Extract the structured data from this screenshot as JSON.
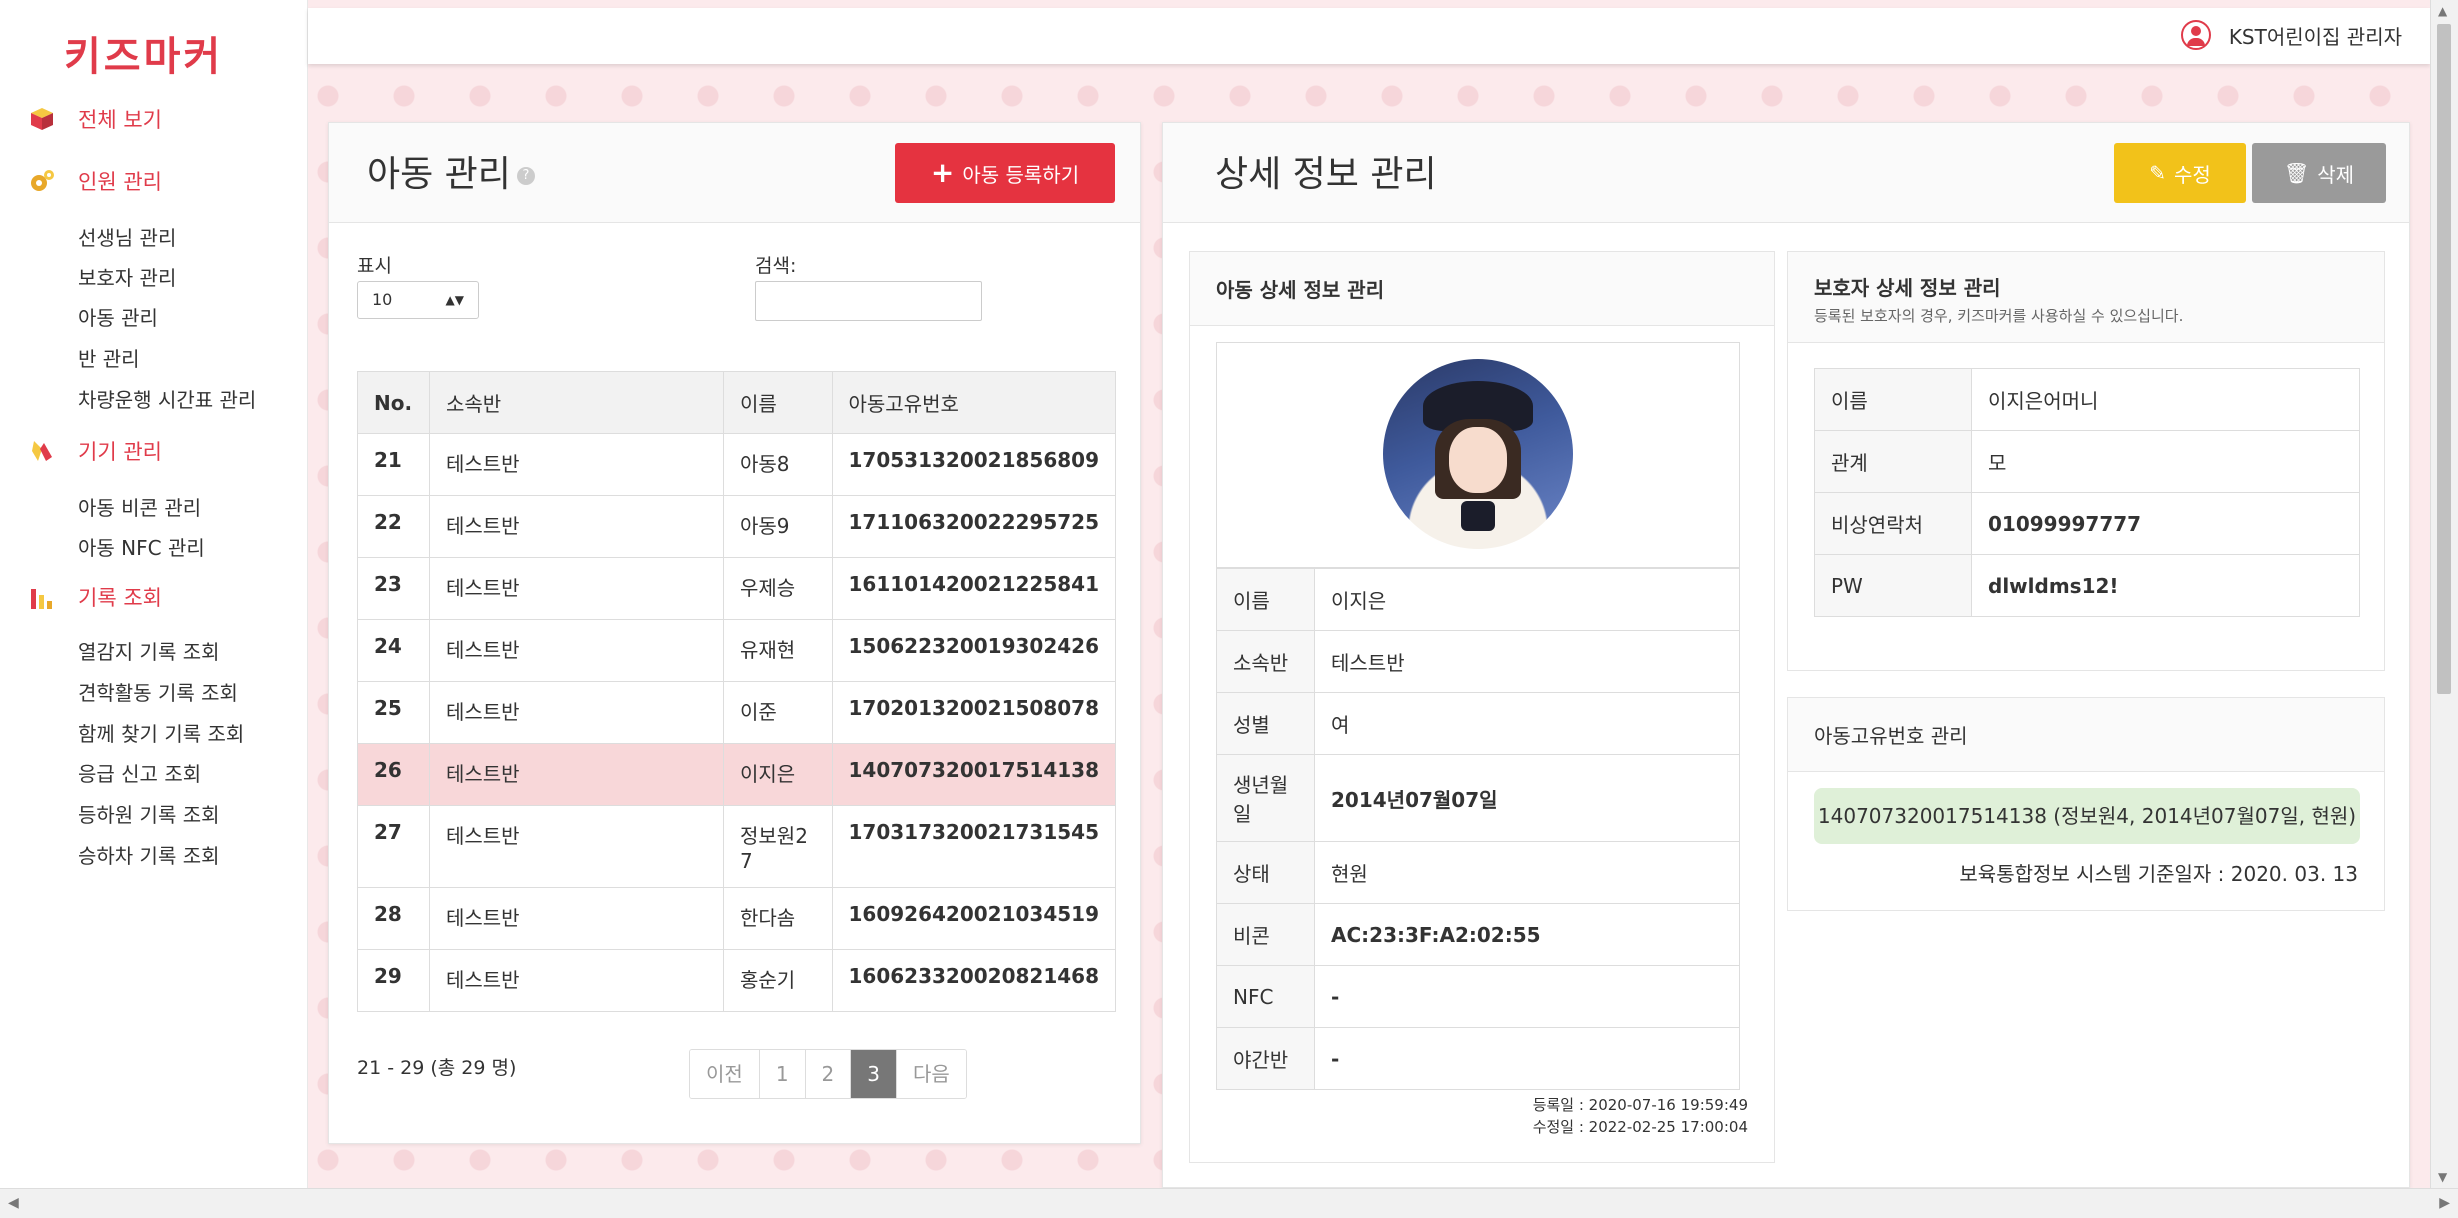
{
  "app": {
    "logo": "키즈마커",
    "user_label": "KST어린이집 관리자"
  },
  "colors": {
    "accent": "#e03b4a",
    "edit": "#f2c21a",
    "delete": "#9a9a9a",
    "selected_row": "#f8d7d9"
  },
  "sidebar": {
    "sections": [
      {
        "label": "전체 보기",
        "icon": "cube-icon"
      },
      {
        "label": "인원 관리",
        "icon": "gear-icon"
      },
      {
        "label": "기기 관리",
        "icon": "bean-icon"
      },
      {
        "label": "기록 조회",
        "icon": "bar-chart-icon"
      }
    ],
    "people_items": [
      "선생님 관리",
      "보호자 관리",
      "아동 관리",
      "반 관리",
      "차량운행 시간표 관리"
    ],
    "device_items": [
      "아동 비콘 관리",
      "아동 NFC 관리"
    ],
    "record_items": [
      "열감지 기록 조회",
      "견학활동 기록 조회",
      "함께 찾기 기록 조회",
      "응급 신고 조회",
      "등하원 기록 조회",
      "승하차 기록 조회"
    ]
  },
  "list": {
    "title": "아동 관리",
    "add_button": "아동 등록하기",
    "show_label": "표시",
    "show_value": "10",
    "search_label": "검색:",
    "search_value": "",
    "columns": [
      "No.",
      "소속반",
      "이름",
      "아동고유번호"
    ],
    "rows": [
      {
        "no": "21",
        "cls": "테스트반",
        "name": "아동8",
        "code": "170531320021856809"
      },
      {
        "no": "22",
        "cls": "테스트반",
        "name": "아동9",
        "code": "171106320022295725"
      },
      {
        "no": "23",
        "cls": "테스트반",
        "name": "우제승",
        "code": "161101420021225841"
      },
      {
        "no": "24",
        "cls": "테스트반",
        "name": "유재현",
        "code": "150622320019302426"
      },
      {
        "no": "25",
        "cls": "테스트반",
        "name": "이준",
        "code": "170201320021508078"
      },
      {
        "no": "26",
        "cls": "테스트반",
        "name": "이지은",
        "code": "140707320017514138"
      },
      {
        "no": "27",
        "cls": "테스트반",
        "name": "정보원27",
        "code": "170317320021731545"
      },
      {
        "no": "28",
        "cls": "테스트반",
        "name": "한다솜",
        "code": "160926420021034519"
      },
      {
        "no": "29",
        "cls": "테스트반",
        "name": "홍순기",
        "code": "160623320020821468"
      }
    ],
    "selected_no": "26",
    "summary": "21 - 29 (총 29 명)",
    "pager": [
      "이전",
      "1",
      "2",
      "3",
      "다음"
    ],
    "current_page": "3"
  },
  "detail": {
    "title": "상세 정보 관리",
    "edit_button": "수정",
    "delete_button": "삭제",
    "child": {
      "title": "아동 상세 정보 관리",
      "fields": [
        {
          "k": "이름",
          "v": "이지은",
          "bold": false
        },
        {
          "k": "소속반",
          "v": "테스트반",
          "bold": false
        },
        {
          "k": "성별",
          "v": "여",
          "bold": false
        },
        {
          "k": "생년월일",
          "v": "2014년07월07일",
          "bold": true
        },
        {
          "k": "상태",
          "v": "현원",
          "bold": false
        },
        {
          "k": "비콘",
          "v": "AC:23:3F:A2:02:55",
          "bold": true
        },
        {
          "k": "NFC",
          "v": "-",
          "bold": true
        },
        {
          "k": "야간반",
          "v": "-",
          "bold": true
        }
      ],
      "registered": "등록일 : 2020-07-16 19:59:49",
      "modified": "수정일 : 2022-02-25 17:00:04"
    },
    "guardian": {
      "title": "보호자 상세 정보 관리",
      "desc": "등록된 보호자의 경우, 키즈마커를 사용하실 수 있으십니다.",
      "fields": [
        {
          "k": "이름",
          "v": "이지은어머니",
          "bold": false
        },
        {
          "k": "관계",
          "v": "모",
          "bold": false
        },
        {
          "k": "비상연락처",
          "v": "01099997777",
          "bold": true
        },
        {
          "k": "PW",
          "v": "dlwldms12!",
          "bold": true
        }
      ]
    },
    "code_mgmt": {
      "title": "아동고유번호 관리",
      "badge": "140707320017514138 (정보원4, 2014년07월07일, 현원)",
      "sys_date": "보육통합정보 시스템 기준일자 : 2020. 03. 13"
    }
  }
}
